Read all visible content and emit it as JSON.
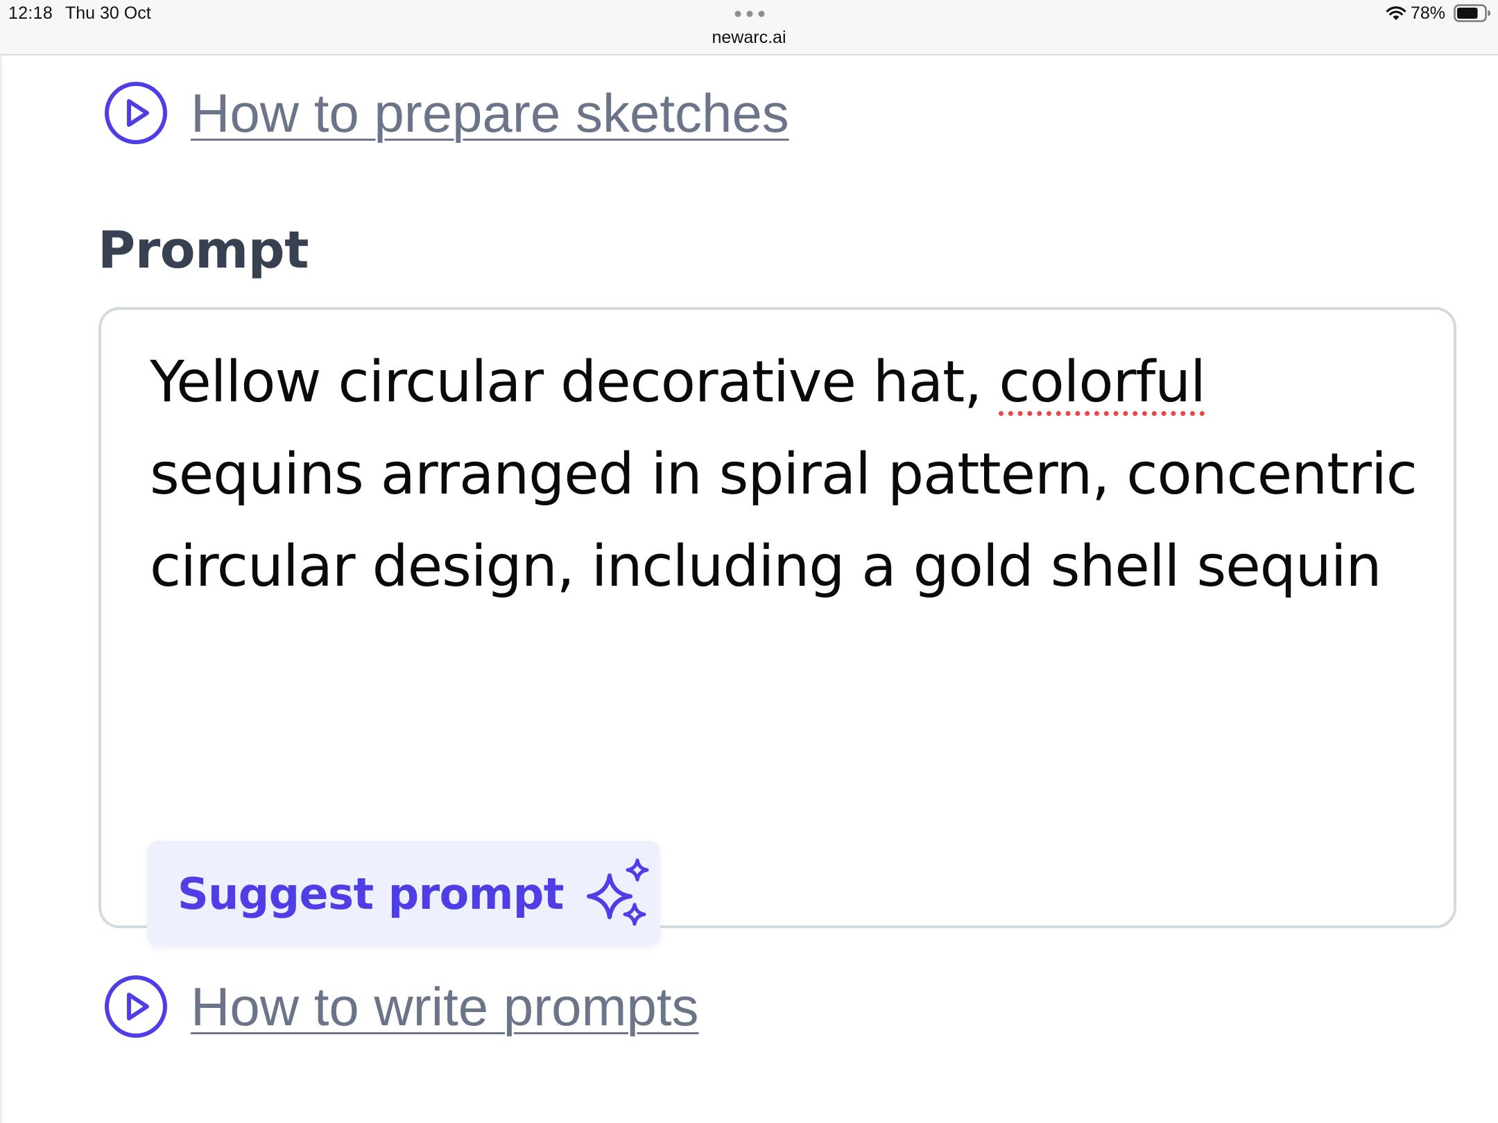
{
  "status_bar": {
    "time": "12:18",
    "date": "Thu 30 Oct",
    "url": "newarc.ai",
    "battery_percent": "78%",
    "battery_level": 0.78,
    "icons": [
      "more-dots-icon",
      "wifi-icon",
      "battery-icon"
    ]
  },
  "links": {
    "prepare_sketches": "How to prepare sketches",
    "write_prompts": "How to write prompts",
    "icon": "play-circle-icon"
  },
  "prompt": {
    "label": "Prompt",
    "text_before": "Yellow circular decorative hat, ",
    "misspelled_word": "colorful",
    "text_after": " sequins arranged in spiral pattern, concentric circular design, including a gold shell sequin"
  },
  "suggest_button": {
    "label": "Suggest prompt",
    "icon": "sparkle-icon"
  },
  "colors": {
    "accent": "#4f3ee6",
    "link": "#6b7488",
    "button_bg": "#eef1fd",
    "spellcheck": "#ef4444"
  }
}
